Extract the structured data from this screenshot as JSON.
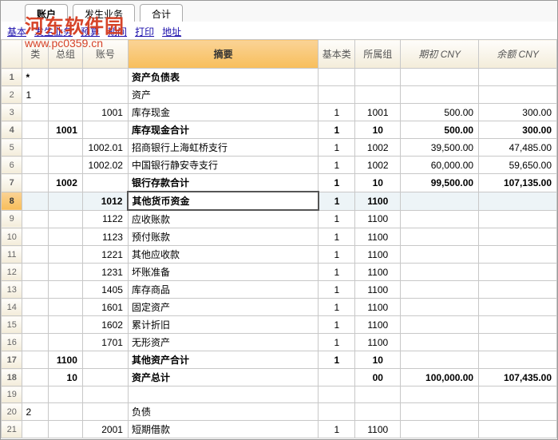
{
  "tabs": {
    "t1": "账户",
    "t2": "发生业务",
    "t3": "合计"
  },
  "sublinks": {
    "l1": "基本",
    "l2": "发生业务",
    "l3": "预算",
    "l4": "期间",
    "l5": "打印",
    "l6": "地址"
  },
  "watermark": {
    "top": "河东软件园",
    "bottom": "www.pc0359.cn"
  },
  "headers": {
    "lei": "类",
    "zongzu": "总组",
    "zhanghao": "账号",
    "summary": "摘要",
    "jiben": "基本类",
    "suoshu": "所属组",
    "qichu": "期初 CNY",
    "yue": "余额 CNY"
  },
  "rows": [
    {
      "n": "1",
      "lei": "*",
      "summary": "资产负债表",
      "bold": true
    },
    {
      "n": "2",
      "lei": "1",
      "summary": "资产"
    },
    {
      "n": "3",
      "zhanghao": "1001",
      "summary": "库存现金",
      "jiben": "1",
      "suoshu": "1001",
      "qichu": "500.00",
      "yue": "300.00"
    },
    {
      "n": "4",
      "zongzu": "1001",
      "summary": "库存现金合计",
      "jiben": "1",
      "suoshu": "10",
      "qichu": "500.00",
      "yue": "300.00",
      "bold": true
    },
    {
      "n": "5",
      "zhanghao": "1002.01",
      "summary": "招商银行上海虹桥支行",
      "jiben": "1",
      "suoshu": "1002",
      "qichu": "39,500.00",
      "yue": "47,485.00"
    },
    {
      "n": "6",
      "zhanghao": "1002.02",
      "summary": "中国银行静安寺支行",
      "jiben": "1",
      "suoshu": "1002",
      "qichu": "60,000.00",
      "yue": "59,650.00"
    },
    {
      "n": "7",
      "zongzu": "1002",
      "summary": "银行存款合计",
      "jiben": "1",
      "suoshu": "10",
      "qichu": "99,500.00",
      "yue": "107,135.00",
      "bold": true
    },
    {
      "n": "8",
      "zhanghao": "1012",
      "summary": "其他货币资金",
      "jiben": "1",
      "suoshu": "1100",
      "edit": true,
      "bold": true
    },
    {
      "n": "9",
      "zhanghao": "1122",
      "summary": "应收账款",
      "jiben": "1",
      "suoshu": "1100"
    },
    {
      "n": "10",
      "zhanghao": "1123",
      "summary": "预付账款",
      "jiben": "1",
      "suoshu": "1100"
    },
    {
      "n": "11",
      "zhanghao": "1221",
      "summary": "其他应收款",
      "jiben": "1",
      "suoshu": "1100"
    },
    {
      "n": "12",
      "zhanghao": "1231",
      "summary": "坏账准备",
      "jiben": "1",
      "suoshu": "1100"
    },
    {
      "n": "13",
      "zhanghao": "1405",
      "summary": "库存商品",
      "jiben": "1",
      "suoshu": "1100"
    },
    {
      "n": "14",
      "zhanghao": "1601",
      "summary": "固定资产",
      "jiben": "1",
      "suoshu": "1100"
    },
    {
      "n": "15",
      "zhanghao": "1602",
      "summary": "累计折旧",
      "jiben": "1",
      "suoshu": "1100"
    },
    {
      "n": "16",
      "zhanghao": "1701",
      "summary": "无形资产",
      "jiben": "1",
      "suoshu": "1100"
    },
    {
      "n": "17",
      "zongzu": "1100",
      "summary": "其他资产合计",
      "jiben": "1",
      "suoshu": "10",
      "bold": true
    },
    {
      "n": "18",
      "zongzu": "10",
      "summary": "资产总计",
      "jiben": "",
      "suoshu": "00",
      "qichu": "100,000.00",
      "yue": "107,435.00",
      "bold": true
    },
    {
      "n": "19"
    },
    {
      "n": "20",
      "lei": "2",
      "summary": "负债"
    },
    {
      "n": "21",
      "zhanghao": "2001",
      "summary": "短期借款",
      "jiben": "1",
      "suoshu": "1100"
    }
  ]
}
